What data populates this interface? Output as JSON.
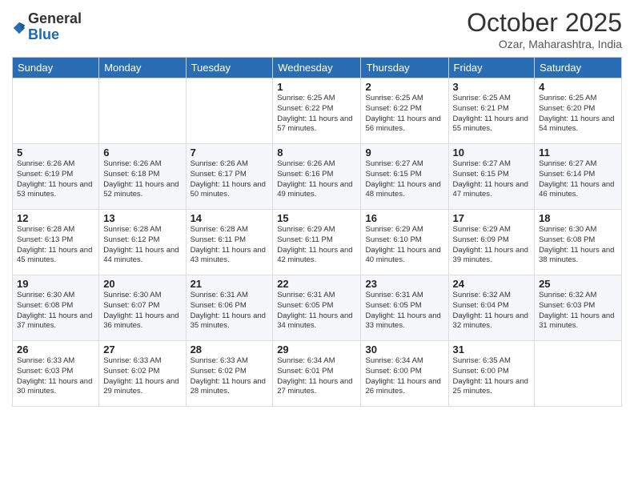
{
  "header": {
    "logo_general": "General",
    "logo_blue": "Blue",
    "month_title": "October 2025",
    "subtitle": "Ozar, Maharashtra, India"
  },
  "days_of_week": [
    "Sunday",
    "Monday",
    "Tuesday",
    "Wednesday",
    "Thursday",
    "Friday",
    "Saturday"
  ],
  "weeks": [
    [
      {
        "day": "",
        "info": ""
      },
      {
        "day": "",
        "info": ""
      },
      {
        "day": "",
        "info": ""
      },
      {
        "day": "1",
        "info": "Sunrise: 6:25 AM\nSunset: 6:22 PM\nDaylight: 11 hours\nand 57 minutes."
      },
      {
        "day": "2",
        "info": "Sunrise: 6:25 AM\nSunset: 6:22 PM\nDaylight: 11 hours\nand 56 minutes."
      },
      {
        "day": "3",
        "info": "Sunrise: 6:25 AM\nSunset: 6:21 PM\nDaylight: 11 hours\nand 55 minutes."
      },
      {
        "day": "4",
        "info": "Sunrise: 6:25 AM\nSunset: 6:20 PM\nDaylight: 11 hours\nand 54 minutes."
      }
    ],
    [
      {
        "day": "5",
        "info": "Sunrise: 6:26 AM\nSunset: 6:19 PM\nDaylight: 11 hours\nand 53 minutes."
      },
      {
        "day": "6",
        "info": "Sunrise: 6:26 AM\nSunset: 6:18 PM\nDaylight: 11 hours\nand 52 minutes."
      },
      {
        "day": "7",
        "info": "Sunrise: 6:26 AM\nSunset: 6:17 PM\nDaylight: 11 hours\nand 50 minutes."
      },
      {
        "day": "8",
        "info": "Sunrise: 6:26 AM\nSunset: 6:16 PM\nDaylight: 11 hours\nand 49 minutes."
      },
      {
        "day": "9",
        "info": "Sunrise: 6:27 AM\nSunset: 6:15 PM\nDaylight: 11 hours\nand 48 minutes."
      },
      {
        "day": "10",
        "info": "Sunrise: 6:27 AM\nSunset: 6:15 PM\nDaylight: 11 hours\nand 47 minutes."
      },
      {
        "day": "11",
        "info": "Sunrise: 6:27 AM\nSunset: 6:14 PM\nDaylight: 11 hours\nand 46 minutes."
      }
    ],
    [
      {
        "day": "12",
        "info": "Sunrise: 6:28 AM\nSunset: 6:13 PM\nDaylight: 11 hours\nand 45 minutes."
      },
      {
        "day": "13",
        "info": "Sunrise: 6:28 AM\nSunset: 6:12 PM\nDaylight: 11 hours\nand 44 minutes."
      },
      {
        "day": "14",
        "info": "Sunrise: 6:28 AM\nSunset: 6:11 PM\nDaylight: 11 hours\nand 43 minutes."
      },
      {
        "day": "15",
        "info": "Sunrise: 6:29 AM\nSunset: 6:11 PM\nDaylight: 11 hours\nand 42 minutes."
      },
      {
        "day": "16",
        "info": "Sunrise: 6:29 AM\nSunset: 6:10 PM\nDaylight: 11 hours\nand 40 minutes."
      },
      {
        "day": "17",
        "info": "Sunrise: 6:29 AM\nSunset: 6:09 PM\nDaylight: 11 hours\nand 39 minutes."
      },
      {
        "day": "18",
        "info": "Sunrise: 6:30 AM\nSunset: 6:08 PM\nDaylight: 11 hours\nand 38 minutes."
      }
    ],
    [
      {
        "day": "19",
        "info": "Sunrise: 6:30 AM\nSunset: 6:08 PM\nDaylight: 11 hours\nand 37 minutes."
      },
      {
        "day": "20",
        "info": "Sunrise: 6:30 AM\nSunset: 6:07 PM\nDaylight: 11 hours\nand 36 minutes."
      },
      {
        "day": "21",
        "info": "Sunrise: 6:31 AM\nSunset: 6:06 PM\nDaylight: 11 hours\nand 35 minutes."
      },
      {
        "day": "22",
        "info": "Sunrise: 6:31 AM\nSunset: 6:05 PM\nDaylight: 11 hours\nand 34 minutes."
      },
      {
        "day": "23",
        "info": "Sunrise: 6:31 AM\nSunset: 6:05 PM\nDaylight: 11 hours\nand 33 minutes."
      },
      {
        "day": "24",
        "info": "Sunrise: 6:32 AM\nSunset: 6:04 PM\nDaylight: 11 hours\nand 32 minutes."
      },
      {
        "day": "25",
        "info": "Sunrise: 6:32 AM\nSunset: 6:03 PM\nDaylight: 11 hours\nand 31 minutes."
      }
    ],
    [
      {
        "day": "26",
        "info": "Sunrise: 6:33 AM\nSunset: 6:03 PM\nDaylight: 11 hours\nand 30 minutes."
      },
      {
        "day": "27",
        "info": "Sunrise: 6:33 AM\nSunset: 6:02 PM\nDaylight: 11 hours\nand 29 minutes."
      },
      {
        "day": "28",
        "info": "Sunrise: 6:33 AM\nSunset: 6:02 PM\nDaylight: 11 hours\nand 28 minutes."
      },
      {
        "day": "29",
        "info": "Sunrise: 6:34 AM\nSunset: 6:01 PM\nDaylight: 11 hours\nand 27 minutes."
      },
      {
        "day": "30",
        "info": "Sunrise: 6:34 AM\nSunset: 6:00 PM\nDaylight: 11 hours\nand 26 minutes."
      },
      {
        "day": "31",
        "info": "Sunrise: 6:35 AM\nSunset: 6:00 PM\nDaylight: 11 hours\nand 25 minutes."
      },
      {
        "day": "",
        "info": ""
      }
    ]
  ]
}
